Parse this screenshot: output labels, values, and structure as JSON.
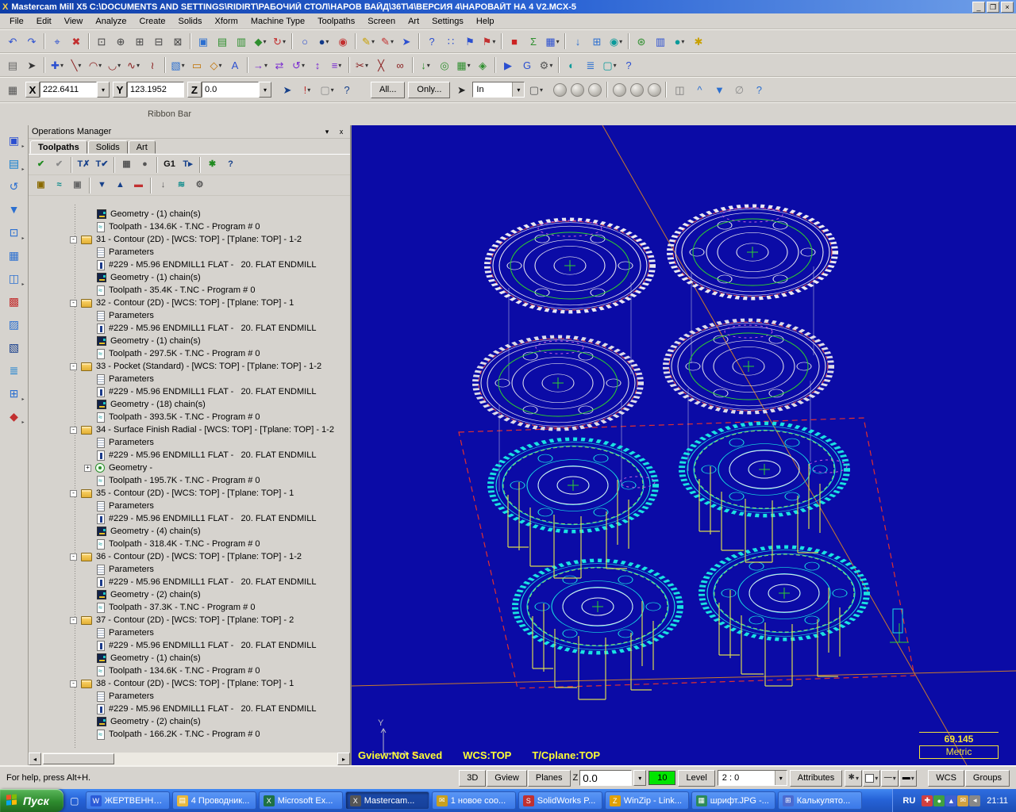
{
  "window": {
    "icon_glyph": "X",
    "title": "Mastercam Mill X5   C:\\DOCUMENTS AND SETTINGS\\RIDIRT\\РАБОЧИЙ СТОЛ\\НАРОВ ВАЙД\\36Т\\4\\ВЕРСИЯ 4\\НАРОВАЙТ НА 4 V2.MCX-5",
    "controls": [
      {
        "n": "minimize",
        "g": "_"
      },
      {
        "n": "maximize",
        "g": "❐"
      },
      {
        "n": "close",
        "g": "×"
      }
    ]
  },
  "icons": {
    "dropdown": "▾",
    "flyout": "▸",
    "scroll_left": "◂",
    "scroll_right": "▸",
    "close": "x",
    "collapse": "▾"
  },
  "menu": {
    "items": [
      "File",
      "Edit",
      "View",
      "Analyze",
      "Create",
      "Solids",
      "Xform",
      "Machine Type",
      "Toolpaths",
      "Screen",
      "Art",
      "Settings",
      "Help"
    ]
  },
  "toolbars": {
    "row1": [
      {
        "n": "undo",
        "g": "↶",
        "c": "#2b4fd0"
      },
      {
        "n": "redo",
        "g": "↷",
        "c": "#2b4fd0"
      },
      "|",
      {
        "n": "analyze-position",
        "g": "⌖",
        "c": "#2b4fd0"
      },
      {
        "n": "delete-entities",
        "g": "✖",
        "c": "#c23030"
      },
      "|",
      {
        "n": "zoom-window",
        "g": "⊡",
        "c": "#444"
      },
      {
        "n": "zoom-target",
        "g": "⊕",
        "c": "#444"
      },
      {
        "n": "zoom-in",
        "g": "⊞",
        "c": "#444"
      },
      {
        "n": "zoom-out",
        "g": "⊟",
        "c": "#444"
      },
      {
        "n": "fit-screen",
        "g": "⊠",
        "c": "#444"
      },
      "|",
      {
        "n": "repaint",
        "g": "▣",
        "c": "#2b6fd0"
      },
      {
        "n": "gview-top",
        "g": "▤",
        "c": "#2f8f2f"
      },
      {
        "n": "gview-front",
        "g": "▥",
        "c": "#2f8f2f"
      },
      {
        "n": "gview-isometric",
        "g": "◆",
        "c": "#2f8f2f",
        "d": 1
      },
      {
        "n": "dynamic-rotate",
        "g": "↻",
        "c": "#c23030",
        "d": 1
      },
      "|",
      {
        "n": "wireframe-display",
        "g": "○",
        "c": "#2b4fd0"
      },
      {
        "n": "shaded-display",
        "g": "●",
        "c": "#123a8a",
        "d": 1
      },
      {
        "n": "analyze-dynamic",
        "g": "◉",
        "c": "#c23030"
      },
      "|",
      {
        "n": "sketcher-pencil",
        "g": "✎",
        "c": "#c8a000",
        "d": 1
      },
      {
        "n": "drafting-pencil",
        "g": "✎",
        "c": "#c23030",
        "d": 1
      },
      {
        "n": "arrow-direction",
        "g": "➤",
        "c": "#2b4fd0"
      },
      "|",
      {
        "n": "help-whats-this",
        "g": "?",
        "c": "#2b4fd0"
      },
      {
        "n": "grid-points",
        "g": "∷",
        "c": "#2b4fd0"
      },
      {
        "n": "flag-set",
        "g": "⚑",
        "c": "#2b4fd0"
      },
      {
        "n": "flag-clear",
        "g": "⚑",
        "c": "#c23030",
        "d": 1
      },
      "|",
      {
        "n": "delete-result",
        "g": "■",
        "c": "#cc2222"
      },
      {
        "n": "sum-analyze",
        "g": "Σ",
        "c": "#2f8f2f"
      },
      {
        "n": "chart-stats",
        "g": "▦",
        "c": "#2b4fd0",
        "d": 1
      },
      "|",
      {
        "n": "file-save",
        "g": "↓",
        "c": "#2b6fd0"
      },
      {
        "n": "grid-manager",
        "g": "⊞",
        "c": "#2b6fd0"
      },
      {
        "n": "spheres-display",
        "g": "◉",
        "c": "#0a9a9a",
        "d": 1
      },
      "|",
      {
        "n": "solids-primitives",
        "g": "⊛",
        "c": "#2f8f2f"
      },
      {
        "n": "nc-editor",
        "g": "▥",
        "c": "#2b4fd0"
      },
      {
        "n": "render-ball",
        "g": "●",
        "c": "#0a9a9a",
        "d": 1
      },
      {
        "n": "tools-wand",
        "g": "✱",
        "c": "#c8a000"
      }
    ],
    "row2": [
      {
        "n": "file-new",
        "g": "▤",
        "c": "#666"
      },
      {
        "n": "selection-arrow",
        "g": "➤",
        "c": "#333"
      },
      "|",
      {
        "n": "create-point",
        "g": "✚",
        "c": "#2b4fd0",
        "d": 1
      },
      {
        "n": "create-line",
        "g": "╲",
        "c": "#8a2020",
        "d": 1
      },
      {
        "n": "create-arc",
        "g": "◠",
        "c": "#8a2020",
        "d": 1
      },
      {
        "n": "create-fillet",
        "g": "◡",
        "c": "#8a2020",
        "d": 1
      },
      {
        "n": "create-spline",
        "g": "∿",
        "c": "#8a2020",
        "d": 1
      },
      {
        "n": "create-curve",
        "g": "≀",
        "c": "#8a2020"
      },
      "|",
      {
        "n": "create-surface",
        "g": "▧",
        "c": "#2b6fd0",
        "d": 1
      },
      {
        "n": "create-rectangle",
        "g": "▭",
        "c": "#c07000"
      },
      {
        "n": "create-polygon",
        "g": "◇",
        "c": "#c07000",
        "d": 1
      },
      {
        "n": "create-letters",
        "g": "A",
        "c": "#2b4fd0"
      },
      "|",
      {
        "n": "xform-translate",
        "g": "→",
        "c": "#7a2bd0",
        "d": 1
      },
      {
        "n": "xform-mirror",
        "g": "⇄",
        "c": "#7a2bd0"
      },
      {
        "n": "xform-rotate",
        "g": "↺",
        "c": "#7a2bd0",
        "d": 1
      },
      {
        "n": "xform-scale",
        "g": "↕",
        "c": "#7a2bd0"
      },
      {
        "n": "xform-offset",
        "g": "≡",
        "c": "#7a2bd0",
        "d": 1
      },
      "|",
      {
        "n": "trim-entities",
        "g": "✂",
        "c": "#8a2020",
        "d": 1
      },
      {
        "n": "break-entities",
        "g": "╳",
        "c": "#8a2020"
      },
      {
        "n": "join-entities",
        "g": "∞",
        "c": "#8a2020"
      },
      "|",
      {
        "n": "toolpath-drill",
        "g": "↓",
        "c": "#2f8f2f",
        "d": 1
      },
      {
        "n": "toolpath-contour",
        "g": "◎",
        "c": "#2f8f2f"
      },
      {
        "n": "toolpath-pocket",
        "g": "▦",
        "c": "#2f8f2f",
        "d": 1
      },
      {
        "n": "toolpath-surface",
        "g": "◈",
        "c": "#2f8f2f"
      },
      "|",
      {
        "n": "machine-simulate",
        "g": "▶",
        "c": "#2b4fd0"
      },
      {
        "n": "post-process",
        "g": "G",
        "c": "#2b4fd0"
      },
      {
        "n": "tool-manager",
        "g": "⚙",
        "c": "#555",
        "d": 1
      },
      "|",
      {
        "n": "material-manager",
        "g": "◐",
        "c": "#0a9a9a"
      },
      {
        "n": "level-manager",
        "g": "≣",
        "c": "#2b6fd0"
      },
      {
        "n": "viewsheets",
        "g": "▢",
        "c": "#0a9a9a",
        "d": 1
      },
      {
        "n": "toolbar-help",
        "g": "?",
        "c": "#2b4fd0"
      }
    ]
  },
  "ribbon": {
    "label": "Ribbon Bar",
    "x_label": "X",
    "x_value": "222.6411",
    "y_label": "Y",
    "y_value": "123.1952",
    "z_label": "Z",
    "z_value": "0.0",
    "all": "All...",
    "only": "Only...",
    "in_value": "In",
    "pre": [
      {
        "n": "fastpoint-mode",
        "g": "▦",
        "c": "#555"
      }
    ],
    "mid": [
      {
        "n": "autocursor-arrow",
        "g": "➤",
        "c": "#16408a"
      },
      {
        "n": "autocursor-override",
        "g": "!",
        "c": "#c03030",
        "d": 1
      },
      {
        "n": "autocursor-cube",
        "g": "▢",
        "c": "#8a8a8a",
        "d": 1
      },
      {
        "n": "autocursor-help",
        "g": "?",
        "c": "#16408a"
      }
    ],
    "sel": [
      {
        "n": "select-pointer",
        "g": "➤",
        "c": "#222"
      }
    ],
    "win": [
      {
        "n": "window-select",
        "g": "▢",
        "c": "#555",
        "d": 1
      }
    ],
    "post": [
      "|",
      {
        "n": "select-grid",
        "g": "◫",
        "c": "#777"
      },
      {
        "n": "select-up",
        "g": "^",
        "c": "#2b6fd0"
      },
      {
        "n": "select-validate",
        "g": "▼",
        "c": "#2b6fd0"
      },
      {
        "n": "select-invert",
        "g": "∅",
        "c": "#8a8a8a"
      },
      {
        "n": "selection-help",
        "g": "?",
        "c": "#2b6fd0"
      }
    ]
  },
  "left_toolbar": [
    {
      "n": "gview-flyout",
      "g": "▣",
      "c": "#2b4fd0",
      "f": 1
    },
    {
      "n": "planes-flyout",
      "g": "▤",
      "c": "#0a7ad0",
      "f": 1
    },
    {
      "n": "dynamic-spin",
      "g": "↺",
      "c": "#2b6fd0"
    },
    {
      "n": "zoom-previous",
      "g": "▼",
      "c": "#2b6fd0"
    },
    {
      "n": "fit-to-screen",
      "g": "⊡",
      "c": "#2b6fd0",
      "f": 1
    },
    {
      "n": "repaint-screen",
      "g": "▦",
      "c": "#2b6fd0"
    },
    {
      "n": "viewport-layout",
      "g": "◫",
      "c": "#2b6fd0",
      "f": 1
    },
    {
      "n": "display-shading",
      "g": "▩",
      "c": "#c23030"
    },
    {
      "n": "hide-entities",
      "g": "▨",
      "c": "#2b6fd0"
    },
    {
      "n": "blank-entities",
      "g": "▧",
      "c": "#123a8a"
    },
    {
      "n": "level-display",
      "g": "≣",
      "c": "#0a7ad0"
    },
    {
      "n": "grid-display",
      "g": "⊞",
      "c": "#2b6fd0",
      "f": 1
    },
    {
      "n": "clear-colors",
      "g": "◆",
      "c": "#c23030",
      "f": 1
    }
  ],
  "operations_manager": {
    "title": "Operations Manager",
    "tabs": [
      "Toolpaths",
      "Solids",
      "Art"
    ],
    "toolbar_a": [
      {
        "n": "select-all-operations",
        "g": "✔",
        "c": "#1f8a1f"
      },
      {
        "n": "select-all-dirty",
        "g": "✔",
        "c": "#8a8a8a"
      },
      "|",
      {
        "n": "regen-selected",
        "g": "T✗",
        "c": "#16408a"
      },
      {
        "n": "regen-all",
        "g": "T✔",
        "c": "#16408a"
      },
      "|",
      {
        "n": "backplot",
        "g": "▦",
        "c": "#555"
      },
      {
        "n": "verify",
        "g": "●",
        "c": "#555"
      },
      "|",
      {
        "n": "post-selected",
        "g": "G1",
        "c": "#111"
      },
      {
        "n": "save-toolpath",
        "g": "T▸",
        "c": "#16408a"
      },
      "|",
      {
        "n": "high-speed",
        "g": "✱",
        "c": "#1f8a1f"
      },
      {
        "n": "ops-help",
        "g": "?",
        "c": "#16408a"
      }
    ],
    "toolbar_b": [
      {
        "n": "lock-toolpaths",
        "g": "▣",
        "c": "#8a6a00"
      },
      {
        "n": "toggle-toolpath-display",
        "g": "≈",
        "c": "#0a8a8a"
      },
      {
        "n": "toggle-post-lock",
        "g": "▣",
        "c": "#666"
      },
      "|",
      {
        "n": "insert-arrow-down",
        "g": "▼",
        "c": "#16408a"
      },
      {
        "n": "insert-arrow-up",
        "g": "▲",
        "c": "#16408a"
      },
      {
        "n": "insert-position",
        "g": "▬",
        "c": "#c23030"
      },
      "|",
      {
        "n": "scroll-to-insert",
        "g": "↓",
        "c": "#555"
      },
      {
        "n": "only-display-selected",
        "g": "≋",
        "c": "#0a8a8a"
      },
      {
        "n": "ops-options",
        "g": "⚙",
        "c": "#555"
      }
    ],
    "tree": [
      {
        "icon": "geom",
        "label": "Geometry - (1) chain(s)"
      },
      {
        "icon": "tp",
        "label": "Toolpath - 134.6K - T.NC - Program # 0"
      },
      {
        "op": true,
        "box": "-",
        "icon": "folder",
        "label": "31 - Contour (2D) - [WCS: TOP] - [Tplane: TOP] - 1-2"
      },
      {
        "icon": "params",
        "label": "Parameters"
      },
      {
        "icon": "tool",
        "label": "#229 - M5.96 ENDMILL1 FLAT -   20. FLAT ENDMILL"
      },
      {
        "icon": "geom",
        "label": "Geometry - (1) chain(s)"
      },
      {
        "icon": "tp",
        "label": "Toolpath - 35.4K - T.NC - Program # 0"
      },
      {
        "op": true,
        "box": "-",
        "icon": "folder",
        "label": "32 - Contour (2D) - [WCS: TOP] - [Tplane: TOP] - 1"
      },
      {
        "icon": "params",
        "label": "Parameters"
      },
      {
        "icon": "tool",
        "label": "#229 - M5.96 ENDMILL1 FLAT -   20. FLAT ENDMILL"
      },
      {
        "icon": "geom",
        "label": "Geometry - (1) chain(s)"
      },
      {
        "icon": "tp",
        "label": "Toolpath - 297.5K - T.NC - Program # 0"
      },
      {
        "op": true,
        "box": "-",
        "icon": "folder",
        "label": "33 - Pocket (Standard) - [WCS: TOP] - [Tplane: TOP] - 1-2"
      },
      {
        "icon": "params",
        "label": "Parameters"
      },
      {
        "icon": "tool",
        "label": "#229 - M5.96 ENDMILL1 FLAT -   20. FLAT ENDMILL"
      },
      {
        "icon": "geom",
        "label": "Geometry - (18) chain(s)"
      },
      {
        "icon": "tp",
        "label": "Toolpath - 393.5K - T.NC - Program # 0"
      },
      {
        "op": true,
        "box": "-",
        "icon": "folder",
        "label": "34 - Surface Finish Radial - [WCS: TOP] - [Tplane: TOP] - 1-2"
      },
      {
        "icon": "params",
        "label": "Parameters"
      },
      {
        "icon": "tool",
        "label": "#229 - M5.96 ENDMILL1 FLAT -   20. FLAT ENDMILL"
      },
      {
        "box": "+",
        "icon": "geomp",
        "label": "Geometry -"
      },
      {
        "icon": "tp",
        "label": "Toolpath - 195.7K - T.NC - Program # 0"
      },
      {
        "op": true,
        "box": "-",
        "icon": "folder",
        "label": "35 - Contour (2D) - [WCS: TOP] - [Tplane: TOP] - 1"
      },
      {
        "icon": "params",
        "label": "Parameters"
      },
      {
        "icon": "tool",
        "label": "#229 - M5.96 ENDMILL1 FLAT -   20. FLAT ENDMILL"
      },
      {
        "icon": "geom",
        "label": "Geometry - (4) chain(s)"
      },
      {
        "icon": "tp",
        "label": "Toolpath - 318.4K - T.NC - Program # 0"
      },
      {
        "op": true,
        "box": "-",
        "icon": "folder",
        "label": "36 - Contour (2D) - [WCS: TOP] - [Tplane: TOP] - 1-2"
      },
      {
        "icon": "params",
        "label": "Parameters"
      },
      {
        "icon": "tool",
        "label": "#229 - M5.96 ENDMILL1 FLAT -   20. FLAT ENDMILL"
      },
      {
        "icon": "geom",
        "label": "Geometry - (2) chain(s)"
      },
      {
        "icon": "tp",
        "label": "Toolpath - 37.3K - T.NC - Program # 0"
      },
      {
        "op": true,
        "box": "-",
        "icon": "folder",
        "label": "37 - Contour (2D) - [WCS: TOP] - [Tplane: TOP] - 2"
      },
      {
        "icon": "params",
        "label": "Parame­ters"
      },
      {
        "icon": "tool",
        "label": "#229 - M5.96 ENDMILL1 FLAT -   20. FLAT ENDMILL"
      },
      {
        "icon": "geom",
        "label": "Geometry - (1) chain(s)"
      },
      {
        "icon": "tp",
        "label": "Toolpath - 134.6K - T.NC - Program # 0"
      },
      {
        "op": true,
        "box": "-",
        "icon": "folder",
        "label": "38 - Contour (2D) - [WCS: TOP] - [Tplane: TOP] - 1"
      },
      {
        "icon": "params",
        "label": "Parameters"
      },
      {
        "icon": "tool",
        "label": "#229 - M5.96 ENDMILL1 FLAT -   20. FLAT ENDMILL"
      },
      {
        "icon": "geom",
        "label": "Geometry - (2) chain(s)"
      },
      {
        "icon": "tp",
        "label": "Toolpath - 166.2K - T.NC - Program # 0"
      }
    ]
  },
  "graphics": {
    "gview_status": "Gview:Not Saved",
    "wcs_status": "WCS:TOP",
    "cplane_status": "T/Cplane:TOP",
    "scale": "69.145",
    "units": "Metric",
    "axis_x": "X",
    "axis_y": "Y"
  },
  "status_bar": {
    "help": "For help, press Alt+H.",
    "view_buttons": [
      "3D",
      "Gview",
      "Planes"
    ],
    "z_label": "Z",
    "z_value": "0.0",
    "ten": "10",
    "level": "Level",
    "level_value": "2 : 0",
    "attributes": "Attributes",
    "mini": [
      {
        "n": "point-style",
        "g": "✱",
        "c": "#333",
        "d": 1
      },
      {
        "n": "entity-color",
        "g": "",
        "c": "#fff",
        "swatch": 1,
        "d": 1
      },
      {
        "n": "line-style",
        "g": "—",
        "c": "#000",
        "d": 1
      },
      {
        "n": "line-width",
        "g": "▬",
        "c": "#000",
        "d": 1
      }
    ],
    "right_buttons": [
      "WCS",
      "Groups"
    ]
  },
  "taskbar": {
    "start": "Пуск",
    "quick": [
      {
        "n": "show-desktop",
        "g": "▢",
        "c": "#eaf2ff"
      }
    ],
    "tasks": [
      {
        "label": "ЖЕРТВЕННА...",
        "n": "word-doc",
        "g": "W",
        "bg": "#2b5bd7"
      },
      {
        "label": "4 Проводник...",
        "n": "explorer-folder",
        "g": "▤",
        "bg": "#e8b83c"
      },
      {
        "label": "Microsoft Ex...",
        "n": "excel",
        "g": "X",
        "bg": "#1e7145"
      },
      {
        "label": "Mastercam...",
        "n": "mastercam-app",
        "g": "X",
        "bg": "#555",
        "active": true
      },
      {
        "label": "1 новое соо...",
        "n": "mail",
        "g": "✉",
        "bg": "#c8a020"
      },
      {
        "label": "SolidWorks P...",
        "n": "solidworks",
        "g": "S",
        "bg": "#c03030"
      },
      {
        "label": "WinZip - Link...",
        "n": "winzip",
        "g": "Z",
        "bg": "#e0a000"
      },
      {
        "label": "шрифт.JPG -...",
        "n": "image-viewer",
        "g": "▦",
        "bg": "#2b8a5a"
      },
      {
        "label": "Калькулято...",
        "n": "calculator",
        "g": "⊞",
        "bg": "#4a6ad0"
      }
    ],
    "lang": "RU",
    "tray": [
      {
        "n": "tray-shield",
        "g": "✚",
        "c": "#d04040"
      },
      {
        "n": "tray-antivirus",
        "g": "●",
        "c": "#40a040"
      },
      {
        "n": "tray-network",
        "g": "▲",
        "c": "#4060d0"
      },
      {
        "n": "tray-message",
        "g": "✉",
        "c": "#d0a040"
      },
      {
        "n": "tray-volume",
        "g": "◂",
        "c": "#888"
      }
    ],
    "time": "21:11"
  }
}
